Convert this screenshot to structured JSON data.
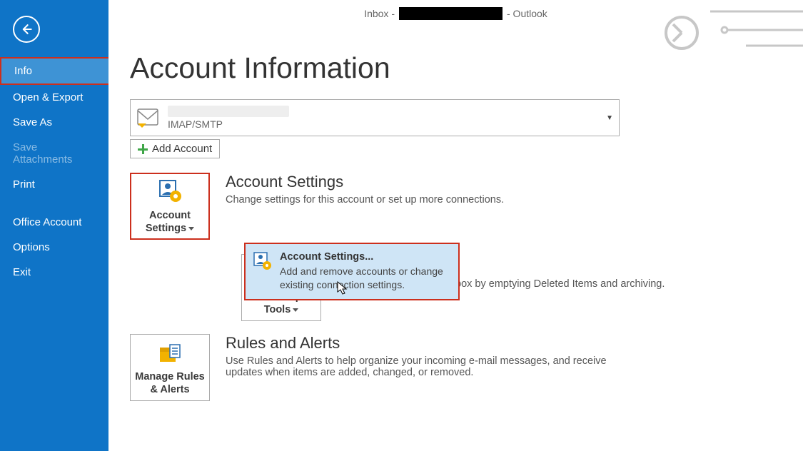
{
  "title_bar": {
    "prefix": "Inbox - ",
    "suffix": " - Outlook"
  },
  "sidebar": {
    "items": [
      {
        "label": "Info",
        "selected": true
      },
      {
        "label": "Open & Export"
      },
      {
        "label": "Save As"
      },
      {
        "label": "Save Attachments",
        "disabled": true
      },
      {
        "label": "Print"
      }
    ],
    "items2": [
      {
        "label": "Office Account"
      },
      {
        "label": "Options"
      },
      {
        "label": "Exit"
      }
    ]
  },
  "page": {
    "heading": "Account Information",
    "account": {
      "type": "IMAP/SMTP"
    },
    "add_account": "Add Account"
  },
  "sections": {
    "account_settings": {
      "button_line1": "Account",
      "button_line2": "Settings",
      "title": "Account Settings",
      "desc": "Change settings for this account or set up more connections."
    },
    "mailbox": {
      "button_line1": "Cleanup",
      "button_line2": "Tools",
      "trail_text": "box by emptying Deleted Items and archiving."
    },
    "rules": {
      "button_line1": "Manage Rules",
      "button_line2": "& Alerts",
      "title": "Rules and Alerts",
      "desc": "Use Rules and Alerts to help organize your incoming e-mail messages, and receive updates when items are added, changed, or removed."
    }
  },
  "popup": {
    "title": "Account Settings...",
    "desc": "Add and remove accounts or change existing connection settings."
  }
}
